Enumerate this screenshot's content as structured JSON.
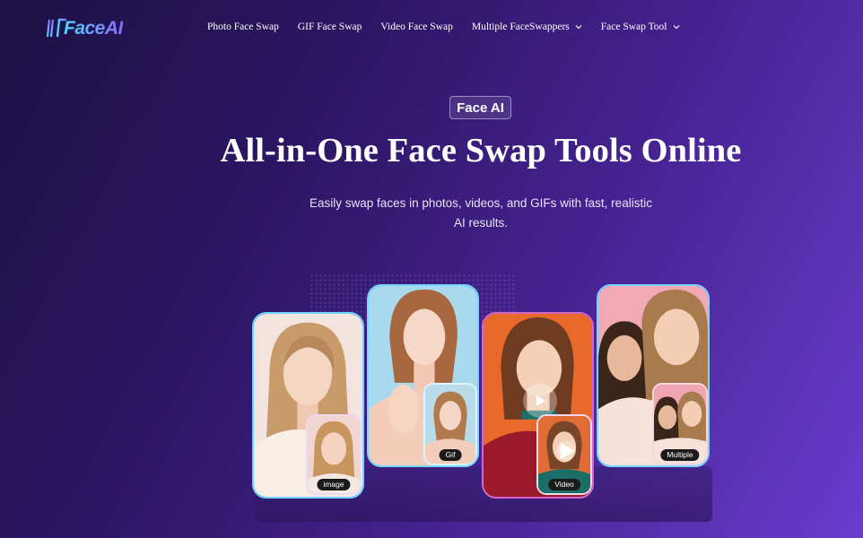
{
  "brand": {
    "name": "FaceAI"
  },
  "nav": {
    "items": [
      {
        "label": "Photo Face Swap"
      },
      {
        "label": "GIF Face Swap"
      },
      {
        "label": "Video Face Swap"
      },
      {
        "label": "Multiple FaceSwappers",
        "dropdown": true
      },
      {
        "label": "Face Swap Tool",
        "dropdown": true
      }
    ]
  },
  "hero": {
    "tag": "Face AI",
    "title": "All-in-One Face Swap Tools Online",
    "subtitle": "Easily swap faces in photos, videos, and GIFs with fast, realistic AI results."
  },
  "cards": [
    {
      "badge": "image"
    },
    {
      "badge": "Gif"
    },
    {
      "badge": "Video"
    },
    {
      "badge": "Multiple"
    }
  ],
  "icons": {
    "logo": "faceai-logo-icon",
    "dropdown": "chevron-down-icon",
    "play": "play-icon"
  }
}
